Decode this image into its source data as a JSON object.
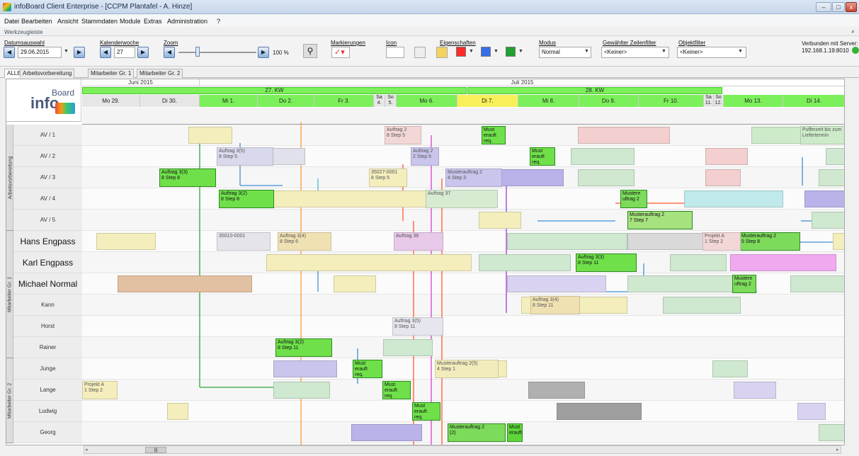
{
  "window": {
    "title": "infoBoard Client Enterprise - [CCPM Plantafel - A. Hinze]",
    "min": "–",
    "max": "□",
    "close": "x"
  },
  "menu": [
    "Datei",
    "Bearbeiten",
    "Ansicht",
    "Stammdaten",
    "Module",
    "Extras",
    "Administration",
    "?"
  ],
  "toolbar": {
    "title": "Werkzeugleiste",
    "date_label": "Datumsauswahl",
    "date_value": "29.06.2015",
    "week_label": "Kalenderwoche",
    "week_value": "27",
    "zoom_label": "Zoom",
    "zoom_value": "100 %",
    "mark_label": "Markierungen",
    "icon_label": "Icon",
    "props_label": "Eigenschaften",
    "mode_label": "Modus",
    "mode_value": "Normal",
    "rowfilter_label": "Gewählter Zeilenfilter",
    "rowfilter_value": "<Keiner>",
    "objfilter_label": "Objektfilter",
    "objfilter_value": "<Keiner>",
    "server_line1": "Verbunden mit Server:",
    "server_line2": "192.168.1.19:8010",
    "colors": {
      "red": "#ff2a2a",
      "blue": "#3a6ee8",
      "green": "#1ea12e"
    }
  },
  "tabs": [
    "ALLE",
    "Arbeitsvorbereitung",
    "Mitarbeiter Gr. 1",
    "Mitarbeiter Gr. 2"
  ],
  "board": {
    "logo_info": "info",
    "logo_board": "Board",
    "months": [
      "Juni 2015",
      "Juli 2015"
    ],
    "weeks": [
      "27. KW",
      "28. KW"
    ],
    "days": [
      "Mo 29.",
      "Di 30.",
      "Mi 1.",
      "Do 2.",
      "Fr 3.",
      "Sa 4.",
      "So 5.",
      "Mo 6.",
      "Di 7.",
      "Mi 8.",
      "Do 9.",
      "Fr 10.",
      "Sa 11.",
      "So 12.",
      "Mo 13.",
      "Di 14."
    ],
    "groups": [
      "Arbeitsvorbereitung",
      "Mitarbeiter Gr. 1",
      "Mitarbeiter Gr. 2"
    ],
    "rows": [
      "AV / 1",
      "AV / 2",
      "AV / 3",
      "AV / 4",
      "AV / 5",
      "Hans Engpass",
      "Karl Engpass",
      "Michael Normal",
      "Kann",
      "Horst",
      "Rainer",
      "Junge",
      "Lange",
      "Ludwig",
      "Georg"
    ],
    "cards": [
      {
        "t": "Auftrag 3(3)\n8 Step 8"
      },
      {
        "t": "Auftrag 3(2)\n8 Step 8"
      },
      {
        "t": "Auftrag 3(3)\n8 Step 11"
      },
      {
        "t": "Auftrag 3(2)\n8 Step 11"
      },
      {
        "t": "Must\nerauft\nreq."
      },
      {
        "t": "Must\nerauft\nreq."
      },
      {
        "t": "Musterauftrag 2\n7 Step 7"
      },
      {
        "t": "Musterauftrag 2\n5 Step 8"
      },
      {
        "t": "Musterauftrag 2\n(2)"
      },
      {
        "t": "Must\nerauft\nreq."
      },
      {
        "t": "Must\nerauft\nreq."
      },
      {
        "t": "Must\nerauft\nreq."
      },
      {
        "t": "Must\nerauft"
      },
      {
        "t": "Mustere\nuftrag 2"
      },
      {
        "t": "Mustere\nuftrag 2"
      },
      {
        "t": "Auftrag 3(5)\n8 Step 5"
      },
      {
        "t": "Auftrag 37"
      },
      {
        "t": "Auftrag 36"
      },
      {
        "t": "Auftrag 3(4)\n8 Step 6"
      },
      {
        "t": "Auftrag 3(5)\n8 Step 11"
      },
      {
        "t": "Auftrag 3(4)\n8 Step 11"
      },
      {
        "t": "Projekt A\n1 Step 2"
      },
      {
        "t": "Pufferzeit bis zum\nLiefertermin"
      },
      {
        "t": "35027-0001\n8 Step 5"
      },
      {
        "t": "35010-0001"
      },
      {
        "t": "Musterauftrag 2(5)\n4 Step 1"
      },
      {
        "t": "Musterauftrag 2\n4 Step 3"
      },
      {
        "t": "Projekt A\n1 Step 2"
      },
      {
        "t": "Auftrag 2\n2 Step 6"
      },
      {
        "t": "Auftrag 2\n8 Step 5"
      }
    ]
  }
}
